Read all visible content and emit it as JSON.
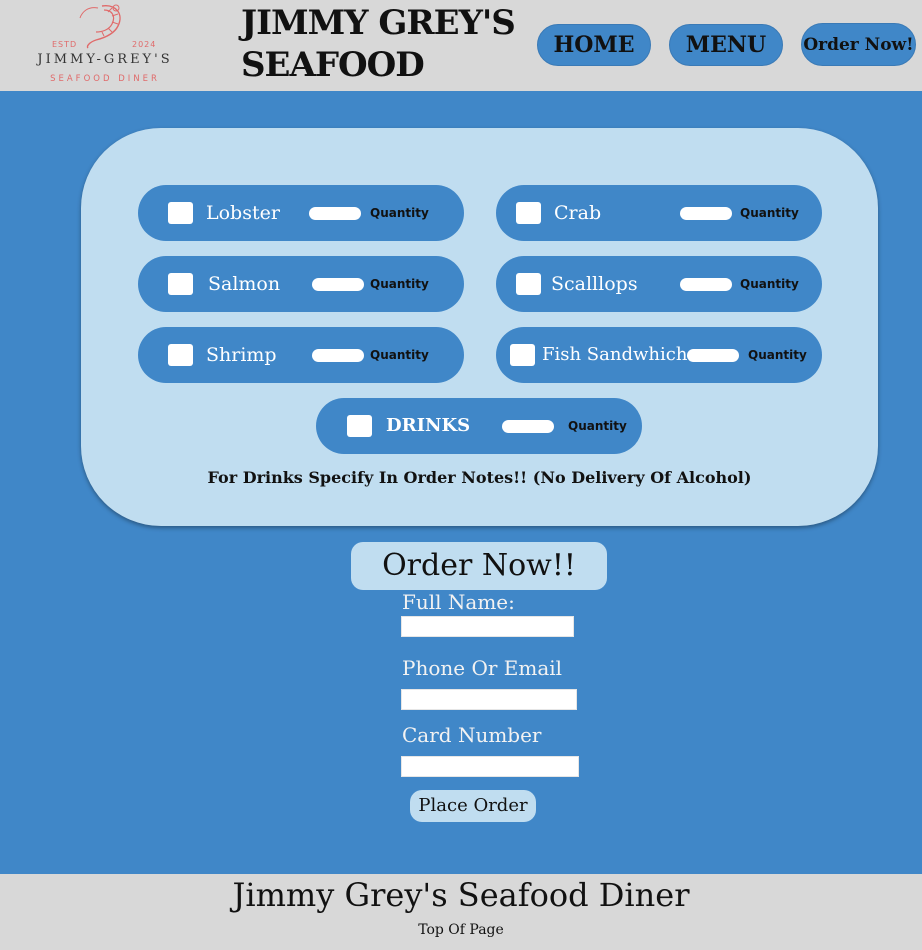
{
  "header": {
    "logo": {
      "estd": "ESTD",
      "year": "2024",
      "name": "JIMMY-GREY'S",
      "subtitle": "SEAFOOD DINER"
    },
    "brand_line1": "JIMMY GREY'S",
    "brand_line2": "SEAFOOD",
    "nav": {
      "home": "HOME",
      "menu": "MENU",
      "order": "Order Now!"
    }
  },
  "menu": {
    "items": [
      {
        "label": "Lobster",
        "quantity_label": "Quantity"
      },
      {
        "label": "Crab",
        "quantity_label": "Quantity"
      },
      {
        "label": "Salmon",
        "quantity_label": "Quantity"
      },
      {
        "label": "Scalllops",
        "quantity_label": "Quantity"
      },
      {
        "label": "Shrimp",
        "quantity_label": "Quantity"
      },
      {
        "label": "Fish Sandwhich",
        "quantity_label": "Quantity"
      },
      {
        "label": "DRINKS",
        "quantity_label": "Quantity"
      }
    ],
    "note": "For Drinks Specify In Order Notes!! (No Delivery Of Alcohol)"
  },
  "order_form": {
    "title": "Order Now!!",
    "full_name_label": "Full Name:",
    "contact_label": "Phone Or Email",
    "card_label": "Card Number",
    "submit_label": "Place Order"
  },
  "footer": {
    "title": "Jimmy Grey's Seafood Diner",
    "top_link": "Top Of Page"
  },
  "colors": {
    "page_background": "#4087c8",
    "panel": "#c0ddf0",
    "header_footer": "#d8d8d8",
    "logo_accent": "#e06a6a"
  }
}
